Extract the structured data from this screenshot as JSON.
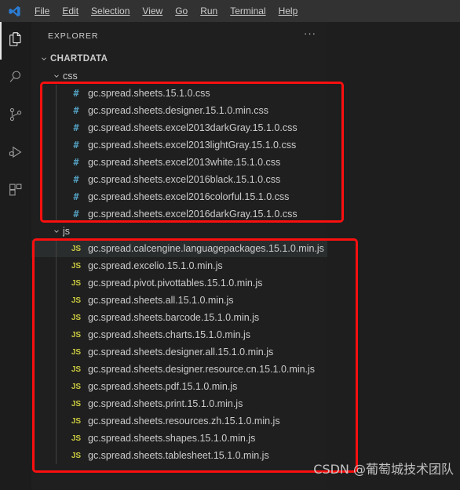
{
  "window": {
    "logo_icon": "vscode-logo-icon"
  },
  "menu": {
    "items": [
      {
        "label": "File"
      },
      {
        "label": "Edit"
      },
      {
        "label": "Selection"
      },
      {
        "label": "View"
      },
      {
        "label": "Go"
      },
      {
        "label": "Run"
      },
      {
        "label": "Terminal"
      },
      {
        "label": "Help"
      }
    ]
  },
  "activity_bar": {
    "items": [
      {
        "name": "explorer-icon",
        "title": "Explorer",
        "active": true
      },
      {
        "name": "search-icon",
        "title": "Search",
        "active": false
      },
      {
        "name": "source-control-icon",
        "title": "Source Control",
        "active": false
      },
      {
        "name": "run-and-debug-icon",
        "title": "Run and Debug",
        "active": false
      },
      {
        "name": "extensions-icon",
        "title": "Extensions",
        "active": false
      }
    ]
  },
  "sidebar": {
    "title": "EXPLORER",
    "more_actions": "···",
    "root_folder": "CHARTDATA",
    "folders": [
      {
        "name": "css",
        "files": [
          "gc.spread.sheets.15.1.0.css",
          "gc.spread.sheets.designer.15.1.0.min.css",
          "gc.spread.sheets.excel2013darkGray.15.1.0.css",
          "gc.spread.sheets.excel2013lightGray.15.1.0.css",
          "gc.spread.sheets.excel2013white.15.1.0.css",
          "gc.spread.sheets.excel2016black.15.1.0.css",
          "gc.spread.sheets.excel2016colorful.15.1.0.css",
          "gc.spread.sheets.excel2016darkGray.15.1.0.css"
        ]
      },
      {
        "name": "js",
        "files": [
          "gc.spread.calcengine.languagepackages.15.1.0.min.js",
          "gc.spread.excelio.15.1.0.min.js",
          "gc.spread.pivot.pivottables.15.1.0.min.js",
          "gc.spread.sheets.all.15.1.0.min.js",
          "gc.spread.sheets.barcode.15.1.0.min.js",
          "gc.spread.sheets.charts.15.1.0.min.js",
          "gc.spread.sheets.designer.all.15.1.0.min.js",
          "gc.spread.sheets.designer.resource.cn.15.1.0.min.js",
          "gc.spread.sheets.pdf.15.1.0.min.js",
          "gc.spread.sheets.print.15.1.0.min.js",
          "gc.spread.sheets.resources.zh.15.1.0.min.js",
          "gc.spread.sheets.shapes.15.1.0.min.js",
          "gc.spread.sheets.tablesheet.15.1.0.min.js"
        ]
      }
    ],
    "css_icon_glyph": "#",
    "js_icon_glyph": "JS",
    "hovered_file": "gc.spread.calcengine.languagepackages.15.1.0.min.js"
  },
  "annotations": {
    "css_box_label": "css-files-highlight-box",
    "js_box_label": "js-files-highlight-box",
    "color": "#fb0f0f"
  },
  "watermark": {
    "text": "CSDN @葡萄城技术团队"
  },
  "colors": {
    "titlebar_bg": "#323233",
    "activitybar_bg": "#1c1c1c",
    "sidebar_bg": "#1f1f1f",
    "editor_bg": "#1e1e1e",
    "text": "#cccccc",
    "css_icon": "#519aba",
    "js_icon": "#cbcb41",
    "hover_row": "#2a2d2e"
  }
}
